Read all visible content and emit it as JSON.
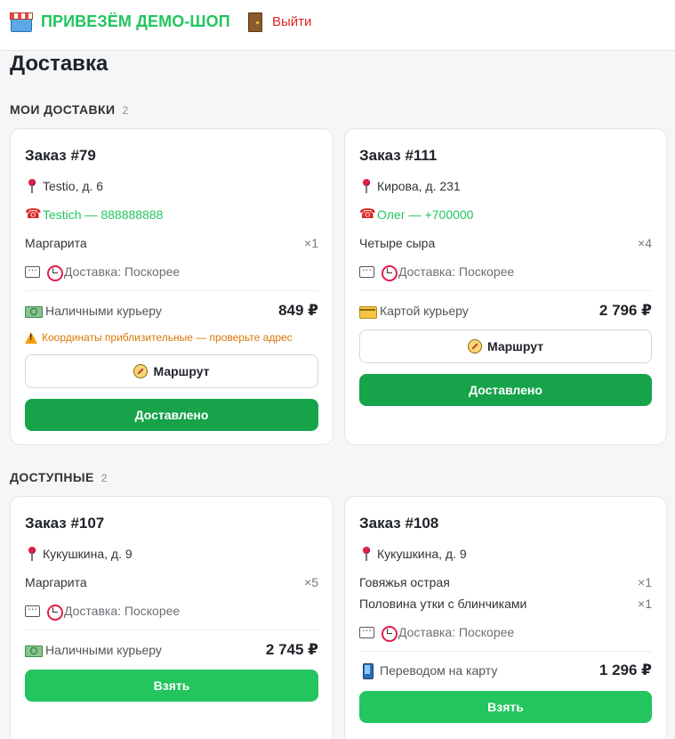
{
  "header": {
    "brand": "ПРИВЕЗЁМ ДЕМО-ШОП",
    "logout": "Выйти"
  },
  "page": {
    "title": "Доставка"
  },
  "sections": [
    {
      "title": "МОИ ДОСТАВКИ",
      "count": "2",
      "orders": [
        {
          "title": "Заказ #79",
          "address": "Testio, д. 6",
          "phone": "Testich — 888888888",
          "items": [
            {
              "name": "Маргарита",
              "qty": "×1"
            }
          ],
          "delivery": "Доставка: Поскорее",
          "payment": "Наличными курьеру",
          "payment_icon": "cash-icon",
          "price": "849 ₽",
          "warning": "Координаты приблизительные — проверьте адрес",
          "route_label": "Маршрут",
          "action_label": "Доставлено"
        },
        {
          "title": "Заказ #111",
          "address": "Кирова, д. 231",
          "phone": "Олег — +700000",
          "items": [
            {
              "name": "Четыре сыра",
              "qty": "×4"
            }
          ],
          "delivery": "Доставка: Поскорее",
          "payment": "Картой курьеру",
          "payment_icon": "credit-card-icon",
          "price": "2 796 ₽",
          "route_label": "Маршрут",
          "action_label": "Доставлено"
        }
      ]
    },
    {
      "title": "ДОСТУПНЫЕ",
      "count": "2",
      "orders": [
        {
          "title": "Заказ #107",
          "address": "Кукушкина, д. 9",
          "items": [
            {
              "name": "Маргарита",
              "qty": "×5"
            }
          ],
          "delivery": "Доставка: Поскорее",
          "payment": "Наличными курьеру",
          "payment_icon": "cash-icon",
          "price": "2 745 ₽",
          "action_label": "Взять"
        },
        {
          "title": "Заказ #108",
          "address": "Кукушкина, д. 9",
          "items": [
            {
              "name": "Говяжья острая",
              "qty": "×1"
            },
            {
              "name": "Половина утки с блинчиками",
              "qty": "×1"
            }
          ],
          "delivery": "Доставка: Поскорее",
          "payment": "Переводом на карту",
          "payment_icon": "mobile-phone-icon",
          "price": "1 296 ₽",
          "action_label": "Взять"
        }
      ]
    }
  ],
  "colors": {
    "brand": "#22c55e",
    "logout": "#dc2626",
    "delivered_button": "#16a34a",
    "take_button": "#22c55e",
    "warning": "#d97706"
  }
}
